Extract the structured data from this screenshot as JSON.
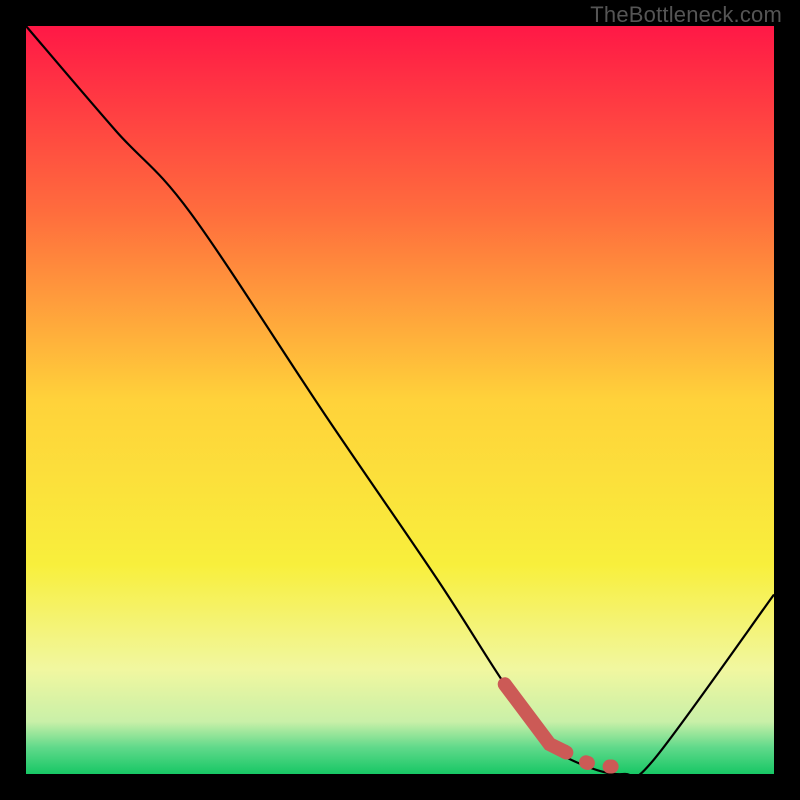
{
  "watermark": "TheBottleneck.com",
  "chart_data": {
    "type": "line",
    "title": "",
    "xlabel": "",
    "ylabel": "",
    "xlim": [
      0,
      100
    ],
    "ylim": [
      0,
      100
    ],
    "grid": false,
    "legend": false,
    "series": [
      {
        "name": "curve",
        "style": "solid-black",
        "x": [
          0,
          12,
          22,
          40,
          55,
          64,
          70,
          75,
          80,
          84,
          100
        ],
        "y": [
          100,
          86,
          75,
          48,
          26,
          12,
          4,
          1,
          0,
          2,
          24
        ]
      },
      {
        "name": "highlight",
        "style": "thick-dashed-red",
        "x": [
          64,
          70,
          72,
          75,
          78,
          81
        ],
        "y": [
          12,
          4,
          3,
          1.5,
          1,
          1
        ]
      }
    ],
    "background_gradient": {
      "stops": [
        {
          "pos": 0.0,
          "color": "#ff1846"
        },
        {
          "pos": 0.25,
          "color": "#ff6d3d"
        },
        {
          "pos": 0.5,
          "color": "#ffd23a"
        },
        {
          "pos": 0.72,
          "color": "#f8ef3c"
        },
        {
          "pos": 0.86,
          "color": "#f1f7a0"
        },
        {
          "pos": 0.93,
          "color": "#c9f0a8"
        },
        {
          "pos": 0.965,
          "color": "#5fd98a"
        },
        {
          "pos": 1.0,
          "color": "#17c765"
        }
      ]
    }
  }
}
